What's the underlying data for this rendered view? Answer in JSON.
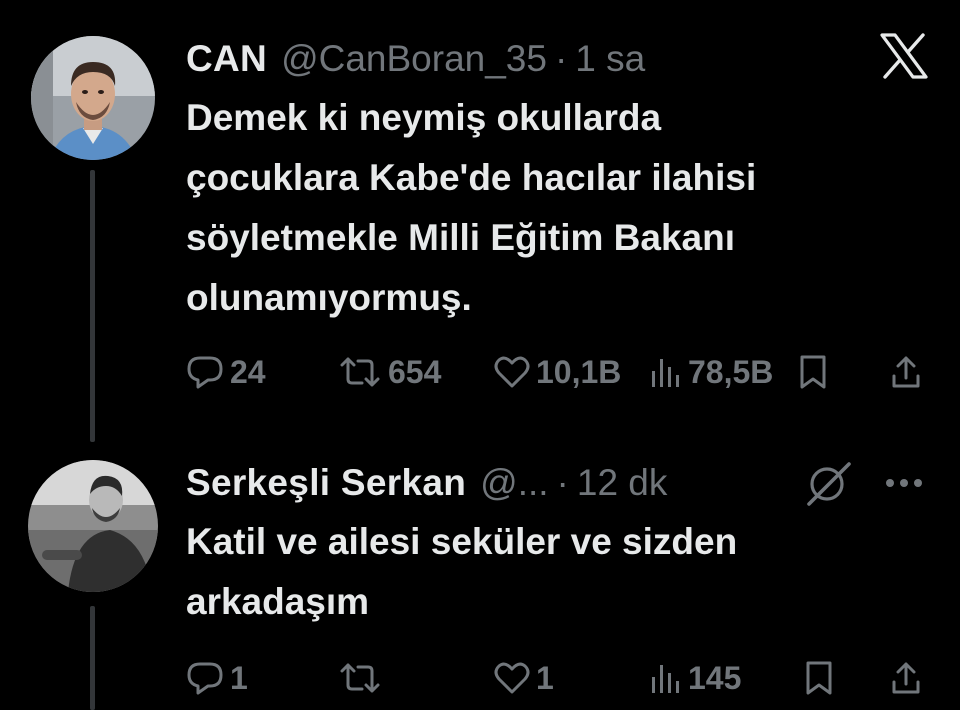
{
  "tweet": {
    "author_name": "CAN",
    "handle": "@CanBoran_35",
    "separator": "·",
    "time": "1 sa",
    "text": "Demek ki neymiş okullarda\nçocuklara Kabe'de hacılar ilahisi\nsöyletmekle Milli Eğitim Bakanı\nolunamıyormuş.",
    "stats": {
      "replies": "24",
      "reposts": "654",
      "likes": "10,1B",
      "views": "78,5B"
    }
  },
  "reply": {
    "author_name": "Serkeşli Serkan",
    "handle": "@...",
    "separator": "·",
    "time": "12 dk",
    "text": "Katil ve ailesi seküler ve sizden\narkadaşım",
    "stats": {
      "replies": "1",
      "reposts": "",
      "likes": "1",
      "views": "145"
    }
  },
  "icons": {
    "platform": "x-logo-icon",
    "grok": "grok-icon",
    "more": "more-icon"
  },
  "colors": {
    "background": "#000000",
    "text_primary": "#e7e9ea",
    "text_secondary": "#71767b",
    "thread_line": "#333639"
  }
}
